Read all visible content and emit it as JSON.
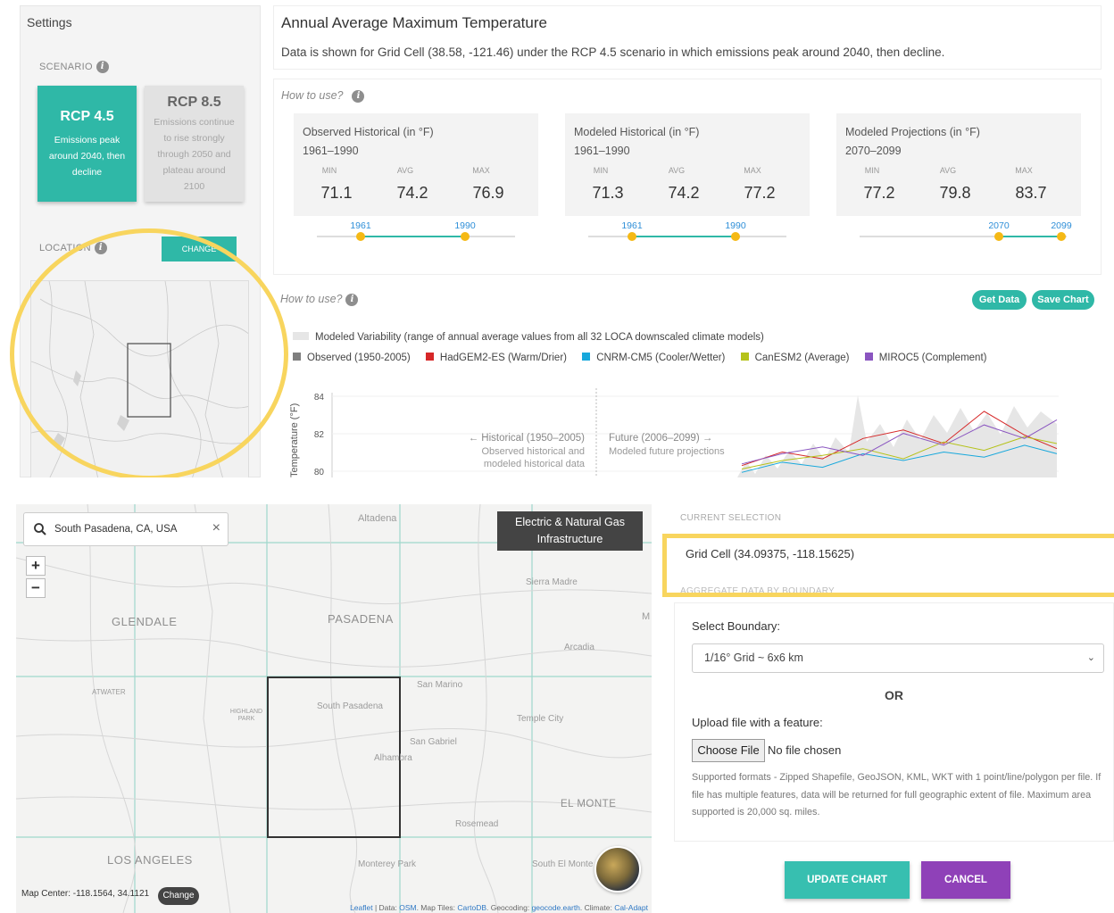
{
  "settings": {
    "title": "Settings",
    "scenario_label": "SCENARIO",
    "location_label": "LOCATION",
    "change_label": "CHANGE",
    "rcp45": {
      "title": "RCP 4.5",
      "desc": "Emissions peak around 2040, then decline"
    },
    "rcp85": {
      "title": "RCP 8.5",
      "desc": "Emissions continue to rise strongly through 2050 and plateau around 2100"
    }
  },
  "header": {
    "title": "Annual Average Maximum Temperature",
    "subtitle": "Data is shown for Grid Cell (38.58, -121.46) under the RCP 4.5 scenario in which emissions peak around 2040, then decline."
  },
  "stats": {
    "howto": "How to use?",
    "headers": {
      "min": "MIN",
      "avg": "AVG",
      "max": "MAX"
    },
    "boxes": [
      {
        "label": "Observed Historical (in °F)",
        "years": "1961–1990",
        "min": "71.1",
        "avg": "74.2",
        "max": "76.9",
        "start": "1961",
        "end": "1990"
      },
      {
        "label": "Modeled Historical (in °F)",
        "years": "1961–1990",
        "min": "71.3",
        "avg": "74.2",
        "max": "77.2",
        "start": "1961",
        "end": "1990"
      },
      {
        "label": "Modeled Projections (in °F)",
        "years": "2070–2099",
        "min": "77.2",
        "avg": "79.8",
        "max": "83.7",
        "start": "2070",
        "end": "2099"
      }
    ]
  },
  "chart": {
    "howto": "How to use?",
    "get_data": "Get Data",
    "save_chart": "Save Chart",
    "variability_legend": "Modeled Variability (range of annual average values from all 32 LOCA downscaled climate models)",
    "colors": {
      "observed": "#7f7f7f",
      "hadgem": "#d62728",
      "cnrm": "#17a8dc",
      "canesm": "#b5c21a",
      "miroc": "#8a55c0",
      "band": "#e6e6e6"
    },
    "legend": [
      {
        "name": "Observed (1950-2005)",
        "color": "#7f7f7f"
      },
      {
        "name": "HadGEM2-ES (Warm/Drier)",
        "color": "#d62728"
      },
      {
        "name": "CNRM-CM5 (Cooler/Wetter)",
        "color": "#17a8dc"
      },
      {
        "name": "CanESM2 (Average)",
        "color": "#b5c21a"
      },
      {
        "name": "MIROC5 (Complement)",
        "color": "#8a55c0"
      }
    ],
    "ylabel": "Temperature (°F)",
    "yticks": [
      "84",
      "82",
      "80"
    ],
    "hist_label": "← Historical (1950–2005)",
    "hist_sub1": "Observed historical and",
    "hist_sub2": "modeled historical data",
    "future_label": "Future (2006–2099) →",
    "future_sub": "Modeled future projections"
  },
  "chart_data": {
    "type": "line",
    "ylabel": "Temperature (°F)",
    "ylim": [
      79.5,
      84.5
    ],
    "series": [
      {
        "name": "HadGEM2-ES (Warm/Drier)",
        "x": [
          2060,
          2065,
          2070,
          2075,
          2080,
          2085,
          2090,
          2095,
          2099
        ],
        "values": [
          80.2,
          81.0,
          80.6,
          81.8,
          82.3,
          81.5,
          83.4,
          82.0,
          81.2
        ]
      },
      {
        "name": "CNRM-CM5 (Cooler/Wetter)",
        "x": [
          2060,
          2065,
          2070,
          2075,
          2080,
          2085,
          2090,
          2095,
          2099
        ],
        "values": [
          79.8,
          80.4,
          80.1,
          80.9,
          80.5,
          81.0,
          80.7,
          81.4,
          80.9
        ]
      },
      {
        "name": "CanESM2 (Average)",
        "x": [
          2060,
          2065,
          2070,
          2075,
          2080,
          2085,
          2090,
          2095,
          2099
        ],
        "values": [
          80.0,
          80.5,
          80.8,
          81.2,
          80.6,
          81.6,
          81.1,
          81.9,
          81.5
        ]
      },
      {
        "name": "MIROC5 (Complement)",
        "x": [
          2060,
          2065,
          2070,
          2075,
          2080,
          2085,
          2090,
          2095,
          2099
        ],
        "values": [
          80.3,
          80.9,
          81.3,
          80.8,
          82.1,
          81.4,
          82.6,
          81.8,
          82.9
        ]
      }
    ]
  },
  "map": {
    "search_value": "South Pasadena, CA, USA",
    "layer_label": "Electric & Natural Gas Infrastructure",
    "center_text": "Map Center: -118.1564, 34.1121",
    "change_label": "Change",
    "attribution": [
      "Leaflet",
      " | Data: ",
      "OSM",
      ". Map Tiles: ",
      "CartoDB",
      ". Geocoding: ",
      "geocode.earth",
      ". Climate: ",
      "Cal-Adapt"
    ],
    "places": {
      "altadena": "Altadena",
      "sierra_madre": "Sierra Madre",
      "glendale": "GLENDALE",
      "pasadena": "PASADENA",
      "arcadia": "Arcadia",
      "atwater": "ATWATER",
      "highland_park": "HIGHLAND PARK",
      "san_marino": "San Marino",
      "south_pasadena": "South Pasadena",
      "temple_city": "Temple City",
      "san_gabriel": "San Gabriel",
      "alhambra": "Alhambra",
      "el_monte": "EL MONTE",
      "rosemead": "Rosemead",
      "los_angeles": "LOS ANGELES",
      "monterey_park": "Monterey Park",
      "south_el_monte": "South El Monte",
      "m": "M"
    }
  },
  "panel": {
    "current_selection_label": "CURRENT SELECTION",
    "grid_cell": "Grid Cell (34.09375, -118.15625)",
    "aggregate_label": "AGGREGATE DATA BY BOUNDARY",
    "select_boundary_label": "Select Boundary:",
    "boundary_value": "1/16° Grid ~ 6x6 km",
    "or": "OR",
    "upload_label": "Upload file with a feature:",
    "choose_file": "Choose File",
    "no_file": "No file chosen",
    "help": "Supported formats - Zipped Shapefile, GeoJSON, KML, WKT with 1 point/line/polygon per file. If file has multiple features, data will be returned for full geographic extent of file. Maximum area supported is 20,000 sq. miles.",
    "update": "UPDATE CHART",
    "cancel": "CANCEL"
  }
}
